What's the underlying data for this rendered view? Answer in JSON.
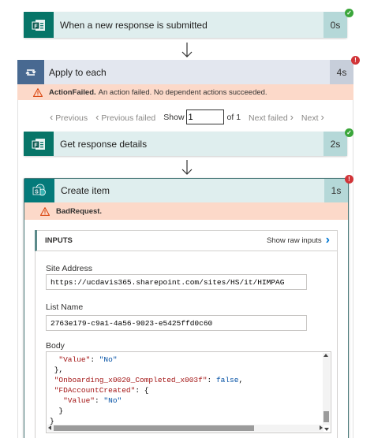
{
  "trigger": {
    "title": "When a new response is submitted",
    "duration": "0s",
    "icon": "forms-icon",
    "status": "success"
  },
  "apply_each": {
    "title": "Apply to each",
    "duration": "4s",
    "icon": "loop-icon",
    "status": "error",
    "error_label": "ActionFailed.",
    "error_message": "An action failed. No dependent actions succeeded."
  },
  "pager": {
    "previous": "Previous",
    "previous_failed": "Previous failed",
    "show": "Show",
    "current": "1",
    "of": "of 1",
    "next_failed": "Next failed",
    "next": "Next"
  },
  "get_details": {
    "title": "Get response details",
    "duration": "2s",
    "icon": "forms-icon",
    "status": "success"
  },
  "create_item": {
    "title": "Create item",
    "duration": "1s",
    "icon": "sharepoint-icon",
    "status": "error",
    "error_label": "BadRequest."
  },
  "inputs": {
    "title": "INPUTS",
    "show_raw": "Show raw inputs",
    "site_address_label": "Site Address",
    "site_address_value": "https://ucdavis365.sharepoint.com/sites/HS/it/HIMPAG",
    "list_name_label": "List Name",
    "list_name_value": "2763e179-c9a1-4a56-9023-e5425ffd0c60",
    "body_label": "Body",
    "body_lines": [
      "\"Value\": \"No\"",
      "},",
      "\"Onboarding_x0020_Completed_x003f\": false,",
      "\"FDAccountCreated\": {",
      "\"Value\": \"No\"",
      "}"
    ]
  },
  "colors": {
    "forms_green": "#077568",
    "card_teal": "#dfeeee",
    "loop_blue": "#486991",
    "loop_card": "#e3e7ef",
    "error_bg": "#fcd9c9",
    "success": "#3aa63a",
    "error": "#d13438"
  }
}
